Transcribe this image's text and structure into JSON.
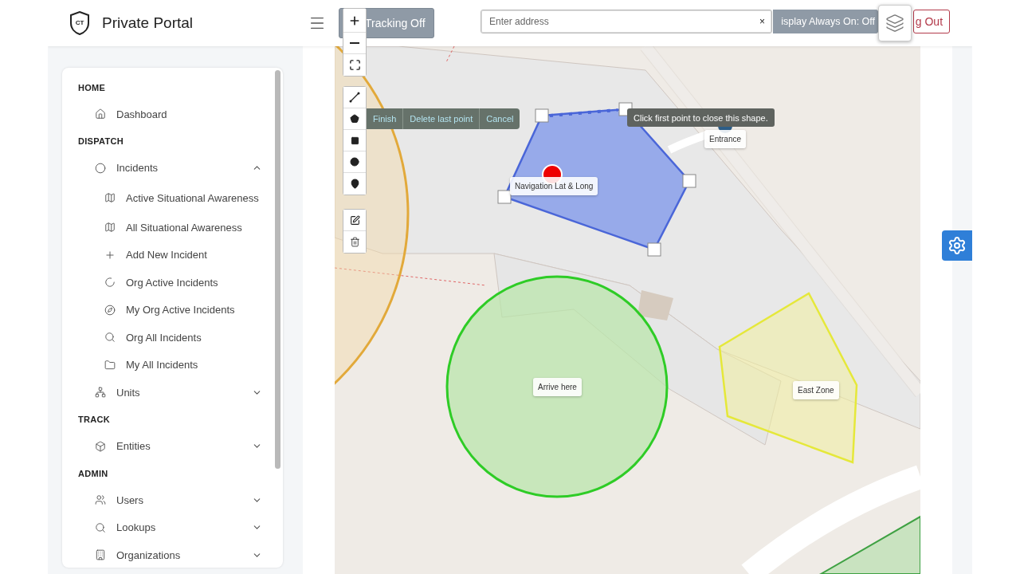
{
  "header": {
    "logo": "CT",
    "title": "Private Portal",
    "tracking_button": "Tracking Off",
    "address_field": {
      "placeholder": "Enter address"
    },
    "clear_button": "×",
    "display_button": "isplay Always On: Off",
    "logout_button": "g Out"
  },
  "sidebar": {
    "sections": [
      {
        "heading": "HOME",
        "items": [
          {
            "label": "Dashboard"
          }
        ]
      },
      {
        "heading": "DISPATCH",
        "items": [
          {
            "label": "Incidents",
            "expanded": true,
            "children": [
              {
                "label": "Active Situational Awareness"
              },
              {
                "label": "All Situational Awareness"
              },
              {
                "label": "Add New Incident"
              },
              {
                "label": "Org Active Incidents"
              },
              {
                "label": "My Org Active Incidents"
              },
              {
                "label": "Org All Incidents"
              },
              {
                "label": "My All Incidents"
              }
            ]
          },
          {
            "label": "Units",
            "expanded": false
          }
        ]
      },
      {
        "heading": "TRACK",
        "items": [
          {
            "label": "Entities",
            "expanded": false
          }
        ]
      },
      {
        "heading": "ADMIN",
        "items": [
          {
            "label": "Users",
            "expanded": false
          },
          {
            "label": "Lookups",
            "expanded": false
          },
          {
            "label": "Organizations",
            "expanded": false
          }
        ]
      }
    ]
  },
  "map": {
    "draw_actions": [
      "Finish",
      "Delete last point",
      "Cancel"
    ],
    "tooltip": "Click first point to close this shape.",
    "labels": [
      {
        "text": "Navigation Lat & Long"
      },
      {
        "text": "Entrance"
      },
      {
        "text": "Arrive here"
      },
      {
        "text": "East Zone"
      }
    ]
  }
}
